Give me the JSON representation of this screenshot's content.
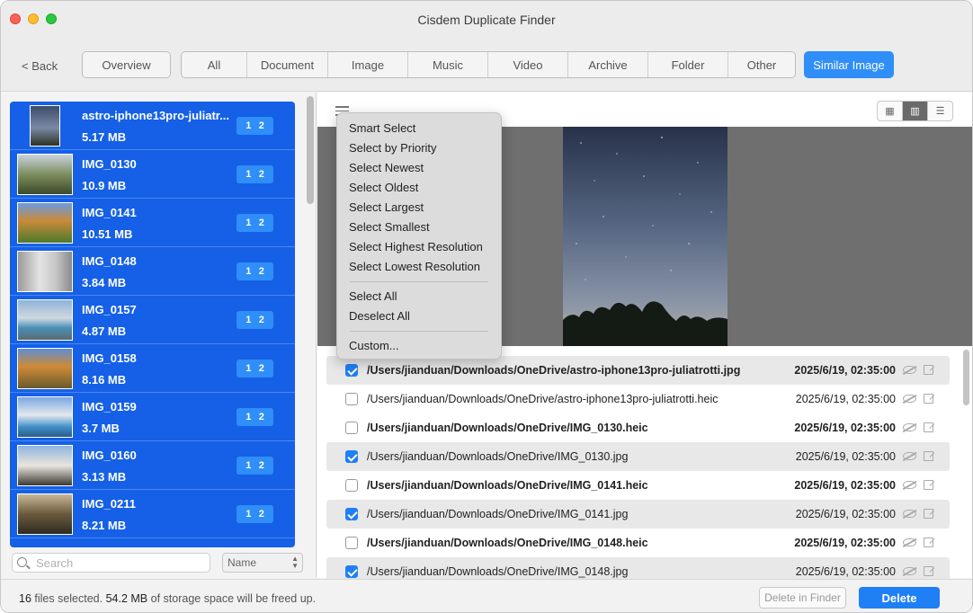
{
  "window": {
    "title": "Cisdem Duplicate Finder"
  },
  "toolbar": {
    "back_label": "< Back",
    "overview_label": "Overview",
    "categories": [
      "All",
      "Document",
      "Image",
      "Music",
      "Video",
      "Archive",
      "Folder",
      "Other"
    ],
    "active_category": "Similar Image"
  },
  "sidebar": {
    "groups": [
      {
        "name": "astro-iphone13pro-juliatr...",
        "size": "5.17 MB",
        "badge": [
          "1",
          "2"
        ]
      },
      {
        "name": "IMG_0130",
        "size": "10.9 MB",
        "badge": [
          "1",
          "2"
        ]
      },
      {
        "name": "IMG_0141",
        "size": "10.51 MB",
        "badge": [
          "1",
          "2"
        ]
      },
      {
        "name": "IMG_0148",
        "size": "3.84 MB",
        "badge": [
          "1",
          "2"
        ]
      },
      {
        "name": "IMG_0157",
        "size": "4.87 MB",
        "badge": [
          "1",
          "2"
        ]
      },
      {
        "name": "IMG_0158",
        "size": "8.16 MB",
        "badge": [
          "1",
          "2"
        ]
      },
      {
        "name": "IMG_0159",
        "size": "3.7 MB",
        "badge": [
          "1",
          "2"
        ]
      },
      {
        "name": "IMG_0160",
        "size": "3.13 MB",
        "badge": [
          "1",
          "2"
        ]
      },
      {
        "name": "IMG_0211",
        "size": "8.21 MB",
        "badge": [
          "1",
          "2"
        ]
      }
    ],
    "search_placeholder": "Search",
    "sort_value": "Name"
  },
  "menu": {
    "group1": [
      "Smart Select",
      "Select by Priority",
      "Select Newest",
      "Select Oldest",
      "Select Largest",
      "Select Smallest",
      "Select Highest Resolution",
      "Select Lowest Resolution"
    ],
    "group2": [
      "Select All",
      "Deselect All"
    ],
    "group3": [
      "Custom..."
    ]
  },
  "files": [
    {
      "path": "/Users/jianduan/Downloads/OneDrive/astro-iphone13pro-juliatrotti.jpg",
      "date": "2025/6/19, 02:35:00",
      "checked": true,
      "bold": true,
      "highlight": true
    },
    {
      "path": "/Users/jianduan/Downloads/OneDrive/astro-iphone13pro-juliatrotti.heic",
      "date": "2025/6/19, 02:35:00",
      "checked": false,
      "bold": false,
      "highlight": false
    },
    {
      "path": "/Users/jianduan/Downloads/OneDrive/IMG_0130.heic",
      "date": "2025/6/19, 02:35:00",
      "checked": false,
      "bold": true,
      "highlight": false
    },
    {
      "path": "/Users/jianduan/Downloads/OneDrive/IMG_0130.jpg",
      "date": "2025/6/19, 02:35:00",
      "checked": true,
      "bold": false,
      "highlight": true
    },
    {
      "path": "/Users/jianduan/Downloads/OneDrive/IMG_0141.heic",
      "date": "2025/6/19, 02:35:00",
      "checked": false,
      "bold": true,
      "highlight": false
    },
    {
      "path": "/Users/jianduan/Downloads/OneDrive/IMG_0141.jpg",
      "date": "2025/6/19, 02:35:00",
      "checked": true,
      "bold": false,
      "highlight": true
    },
    {
      "path": "/Users/jianduan/Downloads/OneDrive/IMG_0148.heic",
      "date": "2025/6/19, 02:35:00",
      "checked": false,
      "bold": true,
      "highlight": false
    },
    {
      "path": "/Users/jianduan/Downloads/OneDrive/IMG_0148.jpg",
      "date": "2025/6/19, 02:35:00",
      "checked": true,
      "bold": false,
      "highlight": true
    }
  ],
  "footer": {
    "count": "16",
    "text1": " files selected. ",
    "size": "54.2 MB",
    "text2": " of storage space will be freed up.",
    "delete_in_finder": "Delete in Finder",
    "delete": "Delete"
  },
  "colors": {
    "accent": "#1f7ff5",
    "sidebar_selected": "#1560e6"
  }
}
